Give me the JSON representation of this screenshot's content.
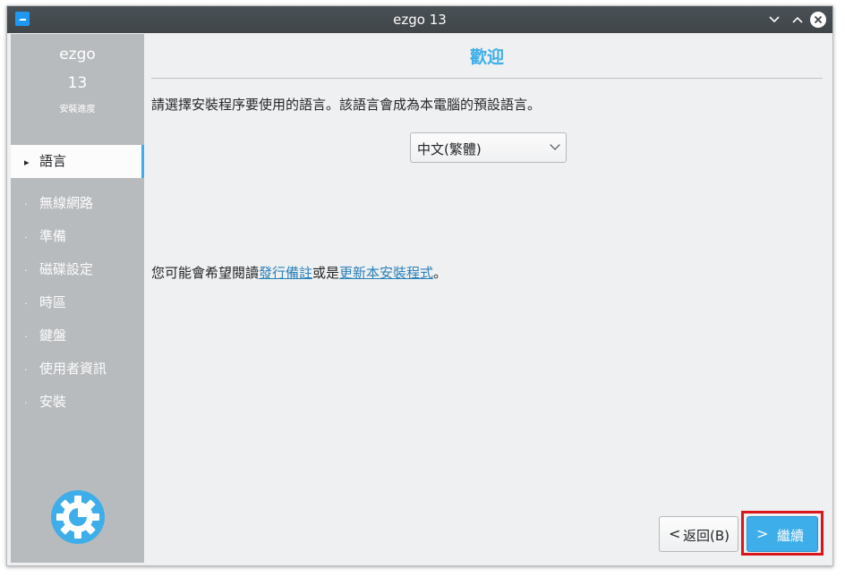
{
  "window": {
    "title": "ezgo 13"
  },
  "titlebar": {
    "minimize_icon": "chevron-down-icon",
    "maximize_icon": "chevron-up-icon",
    "close_icon": "close-icon"
  },
  "sidebar": {
    "name": "ezgo",
    "version": "13",
    "subtitle": "安裝進度",
    "steps": [
      {
        "label": "語言",
        "marker": "▸",
        "active": true
      },
      {
        "label": "無線網路",
        "marker": "·"
      },
      {
        "label": "準備",
        "marker": "·"
      },
      {
        "label": "磁碟設定",
        "marker": "·"
      },
      {
        "label": "時區",
        "marker": "·"
      },
      {
        "label": "鍵盤",
        "marker": "·"
      },
      {
        "label": "使用者資訊",
        "marker": "·"
      },
      {
        "label": "安裝",
        "marker": "·"
      }
    ],
    "logo_icon": "gear-logo-icon"
  },
  "main": {
    "title": "歡迎",
    "prompt": "請選擇安裝程序要使用的語言。該語言會成為本電腦的預設語言。",
    "language_select": {
      "value": "中文(繁體)"
    },
    "notes": {
      "prefix": "您可能會希望閱讀",
      "release_notes_link": "發行備註",
      "middle": "或是",
      "update_installer_link": "更新本安裝程式",
      "suffix": "。"
    }
  },
  "buttons": {
    "back": {
      "arrow": "<",
      "label": "返回(B)"
    },
    "next": {
      "arrow": ">",
      "label": "繼續"
    }
  },
  "colors": {
    "accent": "#3daee9",
    "sidebar_bg": "#b8bbbe",
    "highlight": "#d9161c",
    "link": "#2980b9"
  }
}
